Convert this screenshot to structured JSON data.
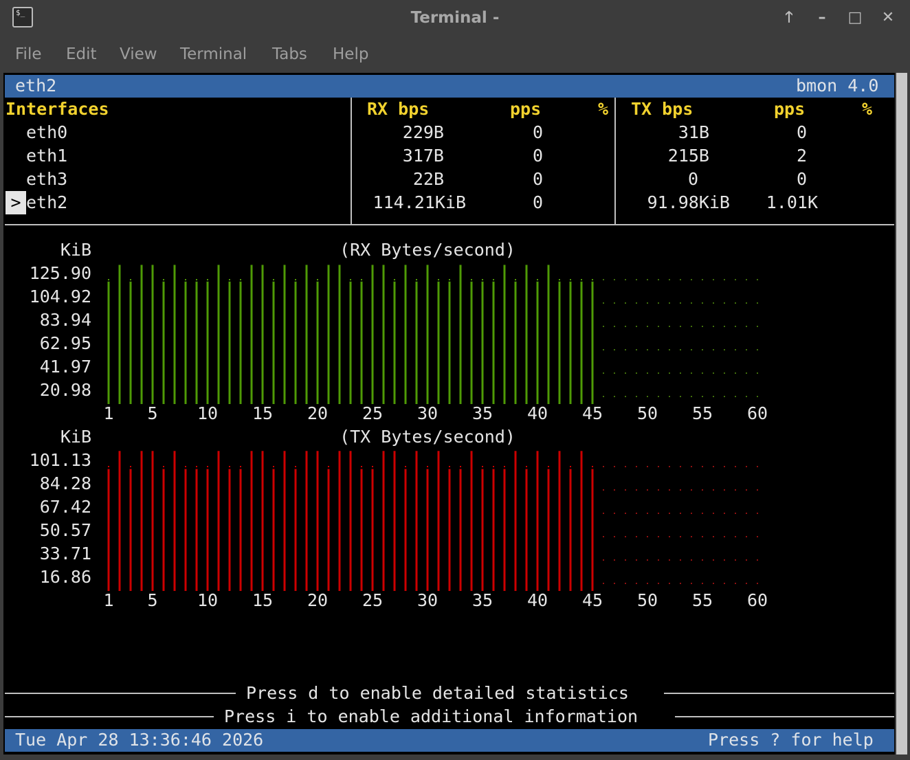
{
  "window": {
    "title": "Terminal -",
    "buttons": [
      "maximize-up",
      "minimize",
      "maximize",
      "close"
    ]
  },
  "menu": [
    "File",
    "Edit",
    "View",
    "Terminal",
    "Tabs",
    "Help"
  ],
  "bmon": {
    "selected_interface": "eth2",
    "version": "bmon 4.0",
    "headers": {
      "interfaces": "Interfaces",
      "rx_bps": "RX bps",
      "rx_pps": "pps",
      "rx_pct": "%",
      "tx_bps": "TX bps",
      "tx_pps": "pps",
      "tx_pct": "%"
    },
    "rows": [
      {
        "name": "eth0",
        "rx_bps": "229B",
        "rx_pps": "0",
        "tx_bps": "31B",
        "tx_pps": "0",
        "selected": false
      },
      {
        "name": "eth1",
        "rx_bps": "317B",
        "rx_pps": "0",
        "tx_bps": "215B",
        "tx_pps": "2",
        "selected": false
      },
      {
        "name": "eth3",
        "rx_bps": "22B",
        "rx_pps": "0",
        "tx_bps": "0",
        "tx_pps": "0",
        "selected": false
      },
      {
        "name": "eth2",
        "rx_bps": "114.21KiB",
        "rx_pps": "0",
        "tx_bps": "91.98KiB",
        "tx_pps": "1.01K",
        "selected": true
      }
    ],
    "selection_marker": ">",
    "footer_hint_1": "Press d to enable detailed statistics",
    "footer_hint_2": "Press i to enable additional information",
    "status_datetime": "Tue Apr 28 13:36:46 2026",
    "status_help": "Press ? for help"
  },
  "chart_data": [
    {
      "type": "bar",
      "title": "(RX Bytes/second)",
      "ylabel": "KiB",
      "y_ticks": [
        "125.90",
        "104.92",
        "83.94",
        "62.95",
        "41.97",
        "20.98"
      ],
      "x_ticks": [
        "1",
        "5",
        "10",
        "15",
        "20",
        "25",
        "30",
        "35",
        "40",
        "45",
        "50",
        "55",
        "60"
      ],
      "color": "#4e9a06",
      "ylim": [
        0,
        125.9
      ],
      "x": [
        1,
        2,
        3,
        4,
        5,
        6,
        7,
        8,
        9,
        10,
        11,
        12,
        13,
        14,
        15,
        16,
        17,
        18,
        19,
        20,
        21,
        22,
        23,
        24,
        25,
        26,
        27,
        28,
        29,
        30,
        31,
        32,
        33,
        34,
        35,
        36,
        37,
        38,
        39,
        40,
        41,
        42,
        43,
        44,
        45
      ],
      "values": [
        110,
        125,
        110,
        125,
        125,
        110,
        125,
        110,
        110,
        110,
        125,
        110,
        110,
        125,
        125,
        110,
        125,
        110,
        125,
        110,
        125,
        125,
        110,
        110,
        125,
        125,
        110,
        125,
        110,
        125,
        110,
        110,
        125,
        110,
        110,
        110,
        125,
        110,
        125,
        110,
        125,
        110,
        110,
        110,
        110
      ]
    },
    {
      "type": "bar",
      "title": "(TX Bytes/second)",
      "ylabel": "KiB",
      "y_ticks": [
        "101.13",
        "84.28",
        "67.42",
        "50.57",
        "33.71",
        "16.86"
      ],
      "x_ticks": [
        "1",
        "5",
        "10",
        "15",
        "20",
        "25",
        "30",
        "35",
        "40",
        "45",
        "50",
        "55",
        "60"
      ],
      "color": "#cc0000",
      "ylim": [
        0,
        101.13
      ],
      "x": [
        1,
        2,
        3,
        4,
        5,
        6,
        7,
        8,
        9,
        10,
        11,
        12,
        13,
        14,
        15,
        16,
        17,
        18,
        19,
        20,
        21,
        22,
        23,
        24,
        25,
        26,
        27,
        28,
        29,
        30,
        31,
        32,
        33,
        34,
        35,
        36,
        37,
        38,
        39,
        40,
        41,
        42,
        43,
        44,
        45
      ],
      "values": [
        88,
        101,
        88,
        101,
        101,
        88,
        101,
        88,
        88,
        88,
        101,
        88,
        88,
        101,
        101,
        88,
        101,
        88,
        101,
        101,
        88,
        101,
        101,
        88,
        88,
        101,
        101,
        88,
        101,
        88,
        101,
        88,
        88,
        101,
        88,
        88,
        88,
        101,
        88,
        101,
        88,
        101,
        88,
        101,
        88
      ]
    }
  ]
}
